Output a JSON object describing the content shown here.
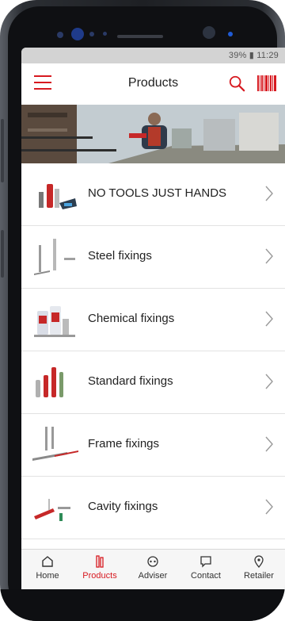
{
  "status_bar": {
    "text": "39% ▮ 11:29"
  },
  "header": {
    "title": "Products"
  },
  "product_categories": [
    {
      "label": "NO TOOLS JUST HANDS"
    },
    {
      "label": "Steel fixings"
    },
    {
      "label": "Chemical fixings"
    },
    {
      "label": "Standard fixings"
    },
    {
      "label": "Frame fixings"
    },
    {
      "label": "Cavity fixings"
    }
  ],
  "tabs": [
    {
      "label": "Home",
      "icon": "home-icon"
    },
    {
      "label": "Products",
      "icon": "products-icon",
      "active": true
    },
    {
      "label": "Adviser",
      "icon": "adviser-icon"
    },
    {
      "label": "Contact",
      "icon": "contact-icon"
    },
    {
      "label": "Retailer",
      "icon": "retailer-icon"
    }
  ],
  "colors": {
    "accent": "#d71920",
    "status_bar": "#d3d3d3",
    "divider": "#e2e2e2",
    "tab_background": "#f6f6f6"
  }
}
